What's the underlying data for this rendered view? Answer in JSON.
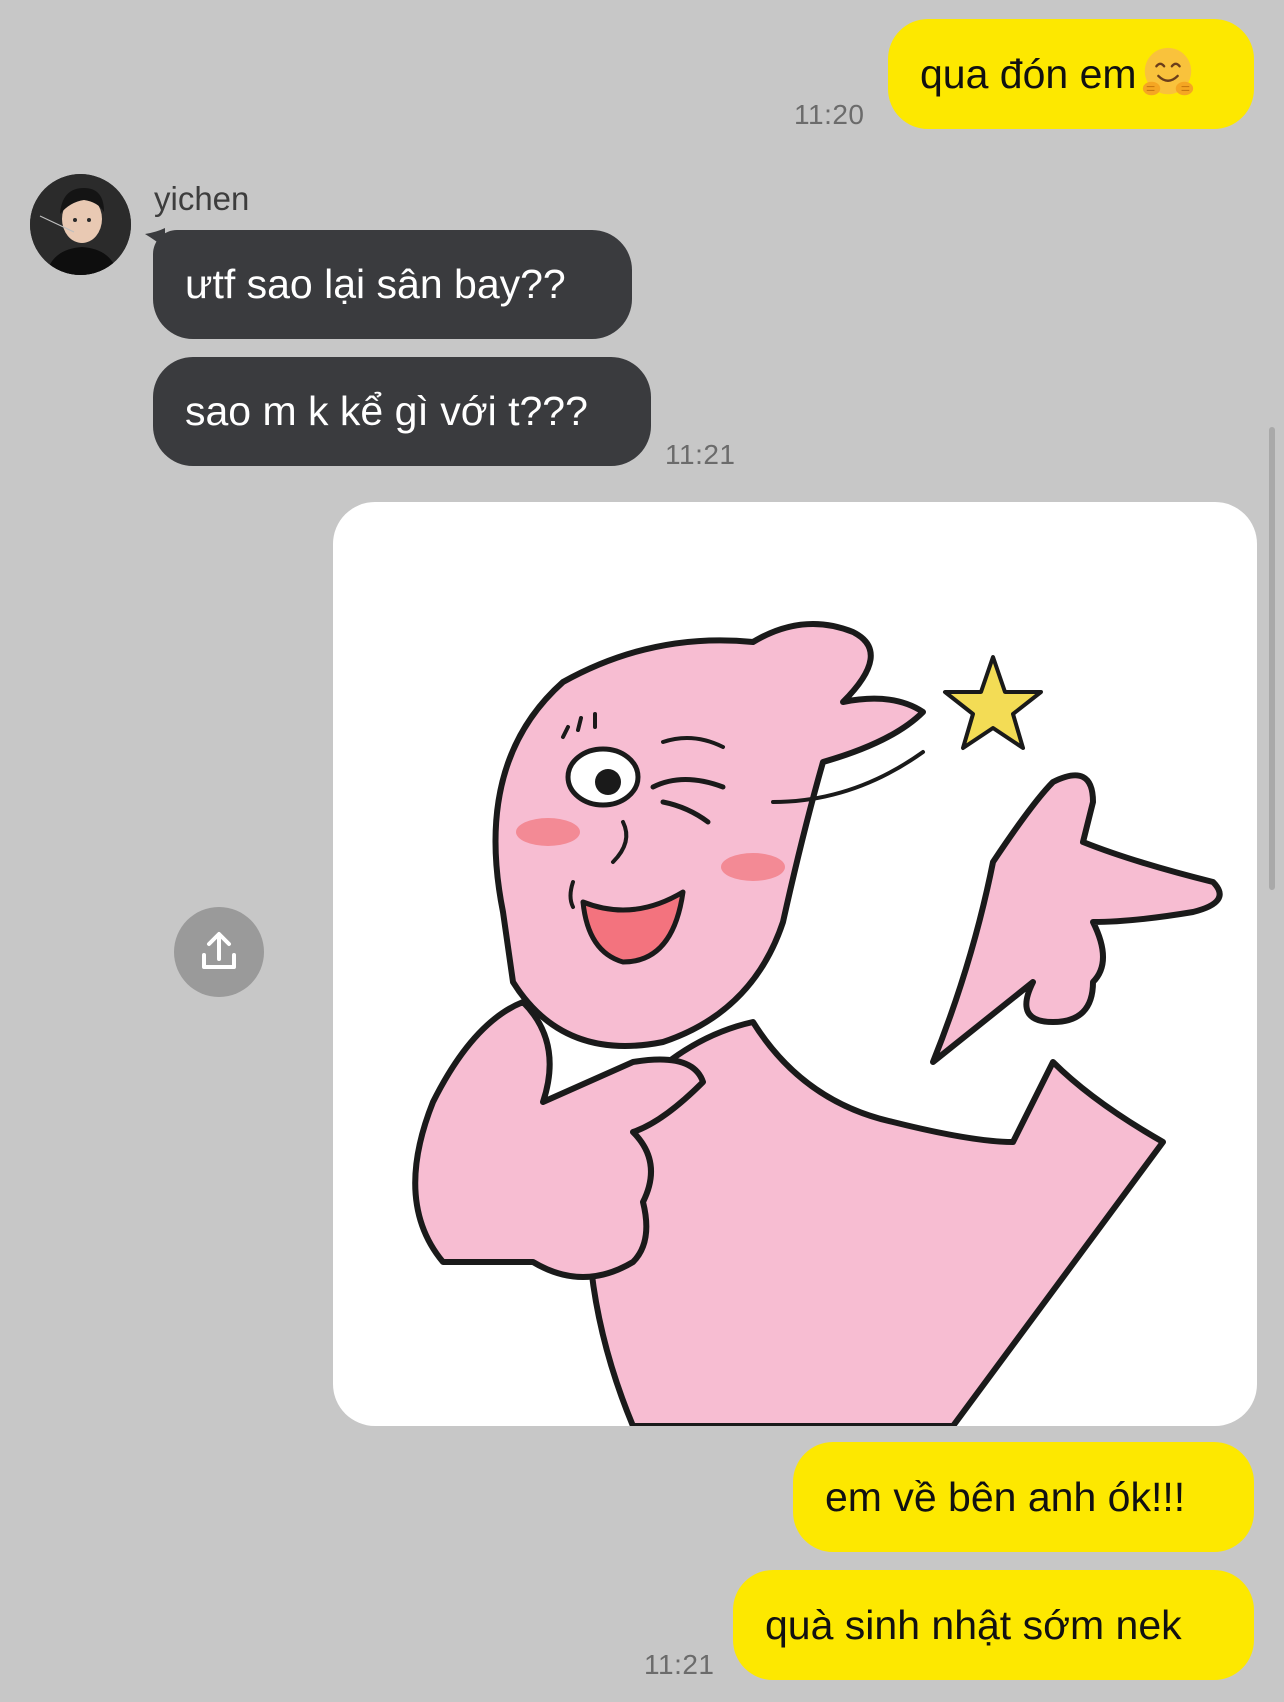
{
  "chat": {
    "messages": [
      {
        "id": "m1",
        "from": "me",
        "text": "qua đón em",
        "emoji": "hugging-face-emoji",
        "time": "11:20"
      },
      {
        "id": "m2",
        "from": "them",
        "text": "ưtf sao lại sân bay??"
      },
      {
        "id": "m3",
        "from": "them",
        "text": "sao m k kể gì với t???",
        "time": "11:21"
      },
      {
        "id": "m4",
        "from": "me",
        "type": "sticker",
        "sticker": "pink-rabbit-wink-pointing-sticker"
      },
      {
        "id": "m5",
        "from": "me",
        "text": "em về bên anh ók!!!"
      },
      {
        "id": "m6",
        "from": "me",
        "text": "quà sinh nhật sớm nek",
        "time": "11:21"
      }
    ]
  },
  "sender": {
    "name": "yichen",
    "avatar": "avatar-photo"
  },
  "icons": {
    "share": "share-upload-icon"
  },
  "colors": {
    "background": "#c7c7c7",
    "my_bubble": "#fde800",
    "their_bubble": "#3a3b3e",
    "sticker_pink": "#f7bdd2",
    "star_yellow": "#f3dc55"
  }
}
